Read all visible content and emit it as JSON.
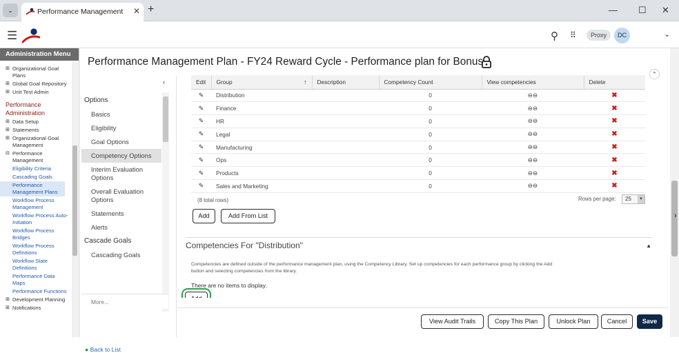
{
  "browser": {
    "tab_title": "Performance Management Plan",
    "tab_close": "✕",
    "new_tab": "+",
    "tab_menu": "⌄",
    "window_controls": {
      "minimize": "—",
      "maximize": "☐",
      "close": "✕"
    }
  },
  "appbar": {
    "menu_icon": "☰",
    "search_icon": "⚲",
    "apps_icon": "⠿",
    "proxy_label": "Proxy",
    "avatar_initials": "DC",
    "account_menu": "⌄"
  },
  "nav": {
    "header": "Administration Menu",
    "items": [
      {
        "label": "Organizational Goal Plans",
        "kind": "exp"
      },
      {
        "label": "Global Goal Repository",
        "kind": "exp"
      },
      {
        "label": "Unit Test Admin",
        "kind": "exp"
      },
      {
        "label": "Performance Administration",
        "kind": "sec"
      },
      {
        "label": "Data Setup",
        "kind": "exp"
      },
      {
        "label": "Statements",
        "kind": "exp"
      },
      {
        "label": "Organizational Goal Management",
        "kind": "exp"
      },
      {
        "label": "Performance Management",
        "kind": "col"
      },
      {
        "label": "Eligibility Criteria",
        "kind": "link"
      },
      {
        "label": "Cascading Goals",
        "kind": "link"
      },
      {
        "label": "Performance Management Plans",
        "kind": "link sel"
      },
      {
        "label": "Workflow Process Management",
        "kind": "link"
      },
      {
        "label": "Workflow Process Auto-Initiation",
        "kind": "link"
      },
      {
        "label": "Workflow Process Bridges",
        "kind": "link"
      },
      {
        "label": "Workflow Process Definitions",
        "kind": "link"
      },
      {
        "label": "Workflow State Definitions",
        "kind": "link"
      },
      {
        "label": "Performance Data Maps",
        "kind": "link"
      },
      {
        "label": "Performance Functions",
        "kind": "link"
      },
      {
        "label": "Development Planning",
        "kind": "exp"
      },
      {
        "label": "Notifications",
        "kind": "exp"
      }
    ]
  },
  "page": {
    "title": "Performance Management Plan - FY24 Reward Cycle - Performance plan for Bonus",
    "collapse_arrow": "‹",
    "scroll_top": "⌃"
  },
  "options": {
    "items": [
      {
        "label": "Options",
        "kind": "hdr"
      },
      {
        "label": "Basics",
        "kind": ""
      },
      {
        "label": "Eligibility",
        "kind": ""
      },
      {
        "label": "Goal Options",
        "kind": ""
      },
      {
        "label": "Competency Options",
        "kind": "sel"
      },
      {
        "label": "Interim Evaluation Options",
        "kind": ""
      },
      {
        "label": "Overall Evaluation Options",
        "kind": ""
      },
      {
        "label": "Statements",
        "kind": ""
      },
      {
        "label": "Alerts",
        "kind": ""
      },
      {
        "label": "Cascade Goals",
        "kind": "hdr"
      },
      {
        "label": "Cascading Goals",
        "kind": ""
      }
    ],
    "more": "More...",
    "back_icon": "●",
    "back_to_list": "Back to List"
  },
  "table": {
    "headers": {
      "edit": "Edit",
      "group": "Group",
      "sort_arrow": "↑",
      "description": "Description",
      "count": "Competency Count",
      "view": "View competencies",
      "delete": "Delete"
    },
    "edit_glyph": "✎",
    "view_glyph": "⊖⊖",
    "delete_glyph": "✖",
    "rows": [
      {
        "group": "Distribution",
        "description": "",
        "count": "0"
      },
      {
        "group": "Finance",
        "description": "",
        "count": "0"
      },
      {
        "group": "HR",
        "description": "",
        "count": "0"
      },
      {
        "group": "Legal",
        "description": "",
        "count": "0"
      },
      {
        "group": "Manufacturing",
        "description": "",
        "count": "0"
      },
      {
        "group": "Ops",
        "description": "",
        "count": "0"
      },
      {
        "group": "Products",
        "description": "",
        "count": "0"
      },
      {
        "group": "Sales and Marketing",
        "description": "",
        "count": "0"
      }
    ],
    "total_rows": "(8 total rows)",
    "rows_per_page_label": "Rows per page:",
    "rows_per_page_value": "25",
    "rows_per_page_arrow": "▾"
  },
  "buttons": {
    "add": "Add",
    "add_from_list": "Add From List",
    "view_audit_trails": "View Audit Trails",
    "copy_this_plan": "Copy This Plan",
    "unlock_plan": "Unlock Plan",
    "cancel": "Cancel",
    "save": "Save"
  },
  "competencies": {
    "header": "Competencies For \"Distribution\"",
    "collapse_glyph": "▲",
    "description": "Competencies are defined outside of the performance management plan, using the Competency Library. Set up competencies for each performance group by clicking the Add button and selecting competencies from the library.",
    "empty_text": "There are no items to display."
  },
  "colors": {
    "accent_red": "#c8211b",
    "save_button": "#102847",
    "highlight_box": "#24a449",
    "nav_header": "#6b6b6b"
  }
}
